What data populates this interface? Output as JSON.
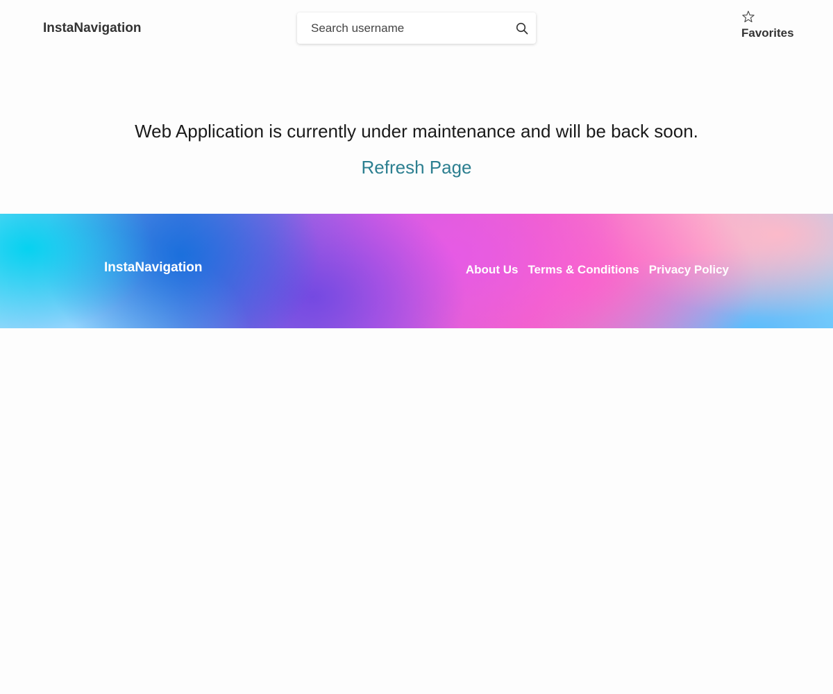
{
  "header": {
    "brand": "InstaNavigation",
    "search": {
      "placeholder": "Search username",
      "value": "",
      "icon": "search-icon"
    },
    "favorites": {
      "label": "Favorites",
      "icon": "star-outline-icon"
    }
  },
  "main": {
    "message": "Web Application is currently under maintenance and will be back soon.",
    "refresh_label": "Refresh Page"
  },
  "footer": {
    "brand": "InstaNavigation",
    "links": [
      {
        "label": "About Us"
      },
      {
        "label": "Terms & Conditions"
      },
      {
        "label": "Privacy Policy"
      }
    ]
  },
  "colors": {
    "link": "#2c7f90",
    "text": "#1a1a1a",
    "background": "#fdfdfd",
    "footer_text": "#ffffff"
  }
}
